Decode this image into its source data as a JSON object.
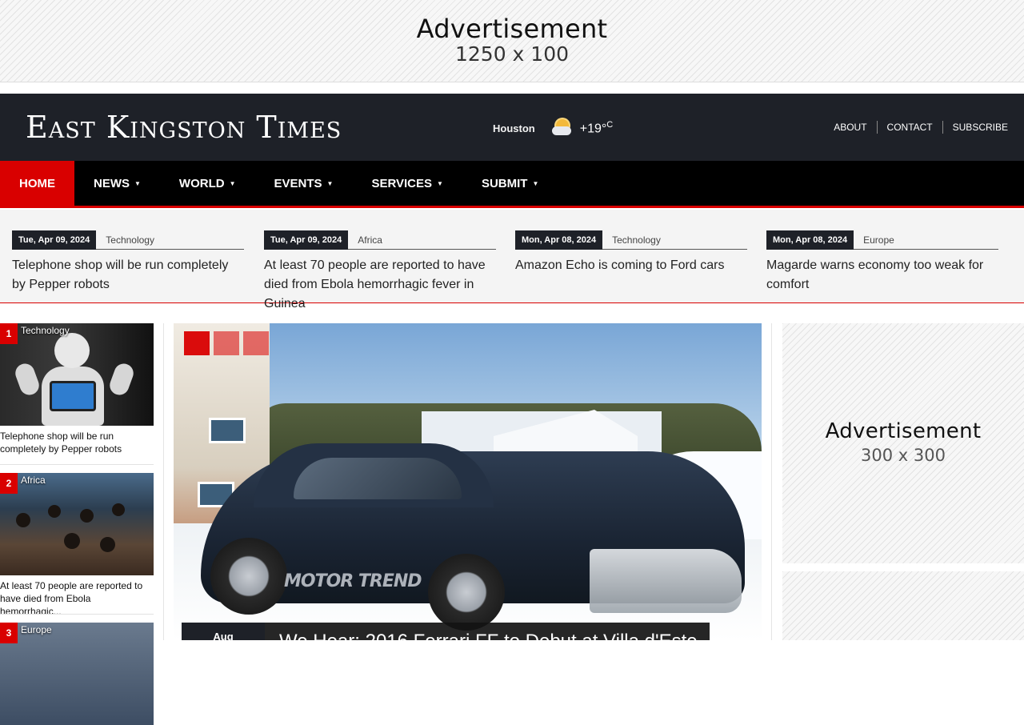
{
  "top_ad": {
    "title": "Advertisement",
    "size": "1250 x 100"
  },
  "header": {
    "site_title": "East Kingston Times",
    "weather": {
      "city": "Houston",
      "temp": "+19°",
      "unit": "C",
      "icon": "partly-cloudy-icon"
    },
    "links": [
      "ABOUT",
      "CONTACT",
      "SUBSCRIBE"
    ]
  },
  "nav": {
    "items": [
      {
        "label": "HOME",
        "active": true,
        "dropdown": false
      },
      {
        "label": "NEWS",
        "active": false,
        "dropdown": true
      },
      {
        "label": "WORLD",
        "active": false,
        "dropdown": true
      },
      {
        "label": "EVENTS",
        "active": false,
        "dropdown": true
      },
      {
        "label": "SERVICES",
        "active": false,
        "dropdown": true
      },
      {
        "label": "SUBMIT",
        "active": false,
        "dropdown": true
      }
    ]
  },
  "ticker": [
    {
      "date": "Tue, Apr 09, 2024",
      "category": "Technology",
      "title": "Telephone shop will be run completely by Pepper robots"
    },
    {
      "date": "Tue, Apr 09, 2024",
      "category": "Africa",
      "title": "At least 70 people are reported to have died from Ebola hemorrhagic fever in Guinea"
    },
    {
      "date": "Mon, Apr 08, 2024",
      "category": "Technology",
      "title": "Amazon Echo is coming to Ford cars"
    },
    {
      "date": "Mon, Apr 08, 2024",
      "category": "Europe",
      "title": "Magarde warns economy too weak for comfort"
    }
  ],
  "side_list": [
    {
      "num": "1",
      "category": "Technology",
      "title": "Telephone shop will be run completely by Pepper robots"
    },
    {
      "num": "2",
      "category": "Africa",
      "title": "At least 70 people are reported to have died from Ebola hemorrhagic..."
    },
    {
      "num": "3",
      "category": "Europe",
      "title": ""
    }
  ],
  "feature": {
    "date": "Aug",
    "title": "We Hear: 2016 Ferrari FF to Debut at Villa d'Este",
    "watermark": "MOTOR TREND",
    "slides": 3,
    "active_slide": 1
  },
  "right_ad": {
    "title": "Advertisement",
    "size": "300 x 300"
  },
  "colors": {
    "accent": "#d90000",
    "header_bg": "#1e2128",
    "nav_bg": "#000000"
  }
}
